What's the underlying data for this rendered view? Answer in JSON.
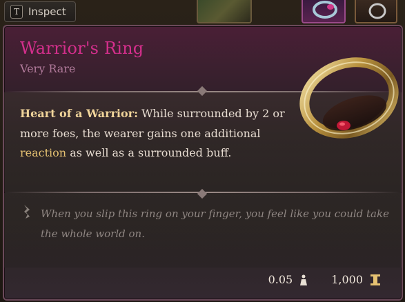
{
  "topbar": {
    "inspect_key": "T",
    "inspect_label": "Inspect"
  },
  "item": {
    "name": "Warrior's Ring",
    "rarity": "Very Rare",
    "feature_name": "Heart of a Warrior:",
    "desc_part1": " While surrounded by 2 or more foes, the wearer gains one additional ",
    "desc_keyword": "reaction",
    "desc_part2": " as well as a surrounded buff.",
    "flavor": "When you slip this ring on your finger, you feel like you could take the whole world on.",
    "weight": "0.05",
    "value": "1,000"
  },
  "colors": {
    "name": "#d42f8c",
    "rarity": "#b07a9a",
    "feature": "#f0d49a",
    "keyword": "#e6c272",
    "flavor": "#8f8682"
  },
  "icons": {
    "quill": "quill-icon",
    "weight": "weight-icon",
    "gold": "gold-icon"
  }
}
